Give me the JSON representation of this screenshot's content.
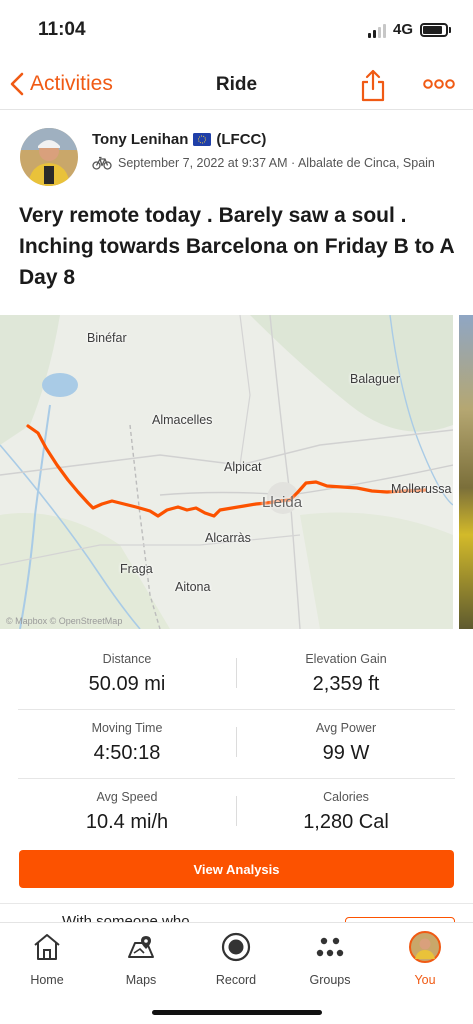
{
  "status_bar": {
    "time": "11:04",
    "network": "4G"
  },
  "nav": {
    "back_label": "Activities",
    "title": "Ride"
  },
  "athlete": {
    "name": "Tony Lenihan",
    "club": "(LFCC)",
    "date_location": "September 7, 2022 at 9:37 AM · Albalate de Cinca, Spain"
  },
  "activity": {
    "title": "Very remote today . Barely saw a soul . Inching towards Barcelona on Friday B to A Day 8"
  },
  "map": {
    "places": [
      "Binéfar",
      "Balaguer",
      "Almacelles",
      "Alpicat",
      "Lleida",
      "Mollerussa",
      "Alcarràs",
      "Fraga",
      "Aitona"
    ],
    "attribution": "© Mapbox © OpenStreetMap",
    "route_color": "#fc5200"
  },
  "stats": [
    [
      {
        "label": "Distance",
        "value": "50.09 mi"
      },
      {
        "label": "Elevation Gain",
        "value": "2,359 ft"
      }
    ],
    [
      {
        "label": "Moving Time",
        "value": "4:50:18"
      },
      {
        "label": "Avg Power",
        "value": "99 W"
      }
    ],
    [
      {
        "label": "Avg Speed",
        "value": "10.4 mi/h"
      },
      {
        "label": "Calories",
        "value": "1,280 Cal"
      }
    ]
  ],
  "cta": {
    "label": "View Analysis"
  },
  "peek": {
    "text": "With someone who"
  },
  "tabs": [
    {
      "label": "Home",
      "icon": "home-icon"
    },
    {
      "label": "Maps",
      "icon": "map-icon"
    },
    {
      "label": "Record",
      "icon": "record-icon"
    },
    {
      "label": "Groups",
      "icon": "groups-icon"
    },
    {
      "label": "You",
      "icon": "avatar-icon"
    }
  ],
  "colors": {
    "accent": "#fc5200",
    "text": "#1f1f1f",
    "muted": "#555555"
  }
}
